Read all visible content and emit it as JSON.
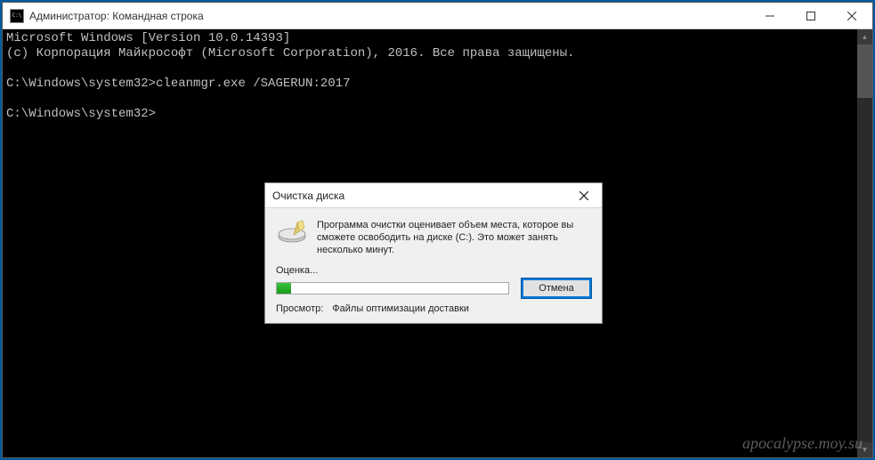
{
  "window": {
    "title": "Администратор: Командная строка"
  },
  "terminal": {
    "line1": "Microsoft Windows [Version 10.0.14393]",
    "line2": "(c) Корпорация Майкрософт (Microsoft Corporation), 2016. Все права защищены.",
    "line3": "",
    "prompt1": "C:\\Windows\\system32>",
    "command1": "cleanmgr.exe /SAGERUN:2017",
    "line4": "",
    "prompt2": "C:\\Windows\\system32>",
    "command2": ""
  },
  "dialog": {
    "title": "Очистка диска",
    "description": "Программа очистки оценивает объем места, которое вы сможете освободить на диске  (C:). Это может занять несколько минут.",
    "status_label": "Оценка...",
    "cancel_label": "Отмена",
    "viewing_label": "Просмотр:",
    "viewing_value": "Файлы оптимизации доставки"
  },
  "watermark": "apocalypse.moy.su"
}
